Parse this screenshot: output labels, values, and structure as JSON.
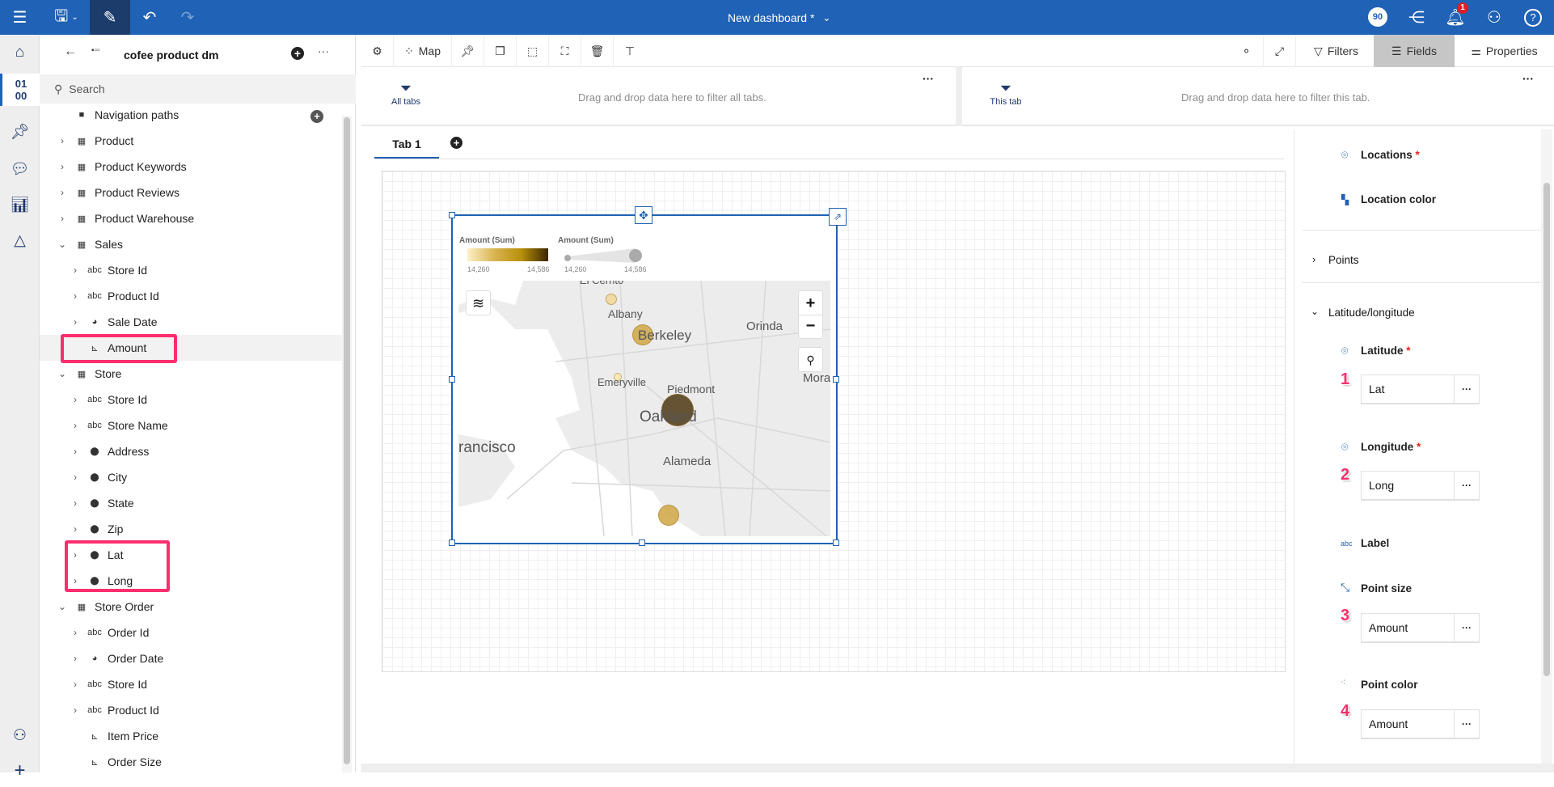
{
  "topbar": {
    "title": "New dashboard *",
    "badge": "90",
    "notifications": "1"
  },
  "leftpanel": {
    "title": "cofee product dm",
    "search_placeholder": "Search",
    "tree": [
      {
        "label": "Navigation paths",
        "icon": "folder-icon",
        "level": 0,
        "chev": ""
      },
      {
        "label": "Product",
        "icon": "table-icon",
        "level": 0,
        "chev": ">"
      },
      {
        "label": "Product Keywords",
        "icon": "table-icon",
        "level": 0,
        "chev": ">"
      },
      {
        "label": "Product Reviews",
        "icon": "table-icon",
        "level": 0,
        "chev": ">"
      },
      {
        "label": "Product Warehouse",
        "icon": "table-icon",
        "level": 0,
        "chev": ">"
      },
      {
        "label": "Sales",
        "icon": "table-icon",
        "level": 0,
        "chev": "v"
      },
      {
        "label": "Store Id",
        "icon": "text-icon",
        "level": 1,
        "chev": ">"
      },
      {
        "label": "Product Id",
        "icon": "text-icon",
        "level": 1,
        "chev": ">"
      },
      {
        "label": "Sale Date",
        "icon": "clock-icon",
        "level": 1,
        "chev": ">"
      },
      {
        "label": "Amount",
        "icon": "measure-icon",
        "level": 1,
        "chev": ""
      },
      {
        "label": "Store",
        "icon": "table-icon",
        "level": 0,
        "chev": "v"
      },
      {
        "label": "Store Id",
        "icon": "text-icon",
        "level": 1,
        "chev": ">"
      },
      {
        "label": "Store Name",
        "icon": "text-icon",
        "level": 1,
        "chev": ">"
      },
      {
        "label": "Address",
        "icon": "location-icon",
        "level": 1,
        "chev": ">"
      },
      {
        "label": "City",
        "icon": "location-icon",
        "level": 1,
        "chev": ">"
      },
      {
        "label": "State",
        "icon": "location-icon",
        "level": 1,
        "chev": ">"
      },
      {
        "label": "Zip",
        "icon": "location-icon",
        "level": 1,
        "chev": ">"
      },
      {
        "label": "Lat",
        "icon": "location-icon",
        "level": 1,
        "chev": ">"
      },
      {
        "label": "Long",
        "icon": "location-icon",
        "level": 1,
        "chev": ">"
      },
      {
        "label": "Store Order",
        "icon": "table-icon",
        "level": 0,
        "chev": "v"
      },
      {
        "label": "Order Id",
        "icon": "text-icon",
        "level": 1,
        "chev": ">"
      },
      {
        "label": "Order Date",
        "icon": "clock-icon",
        "level": 1,
        "chev": ">"
      },
      {
        "label": "Store Id",
        "icon": "text-icon",
        "level": 1,
        "chev": ">"
      },
      {
        "label": "Product Id",
        "icon": "text-icon",
        "level": 1,
        "chev": ">"
      },
      {
        "label": "Item Price",
        "icon": "measure-icon",
        "level": 1,
        "chev": ""
      },
      {
        "label": "Order Size",
        "icon": "measure-icon",
        "level": 1,
        "chev": ""
      }
    ]
  },
  "toolbar": {
    "map_label": "Map",
    "filters": "Filters",
    "fields": "Fields",
    "properties": "Properties"
  },
  "filters": {
    "all_tabs": "All tabs",
    "all_msg": "Drag and drop data here to filter all tabs.",
    "this_tab": "This tab",
    "this_msg": "Drag and drop data here to filter this tab."
  },
  "tabs": [
    {
      "label": "Tab 1",
      "active": true
    }
  ],
  "map": {
    "legend_color": {
      "title": "Amount (Sum)",
      "min": "14,260",
      "max": "14,586",
      "colors": [
        "#fdf0c8",
        "#b8900a",
        "#3a2600"
      ]
    },
    "legend_size": {
      "title": "Amount (Sum)",
      "min": "14,260",
      "max": "14,586"
    },
    "places": [
      "El Cerrito",
      "Albany",
      "Berkeley",
      "Orinda",
      "Emeryville",
      "Piedmont",
      "Oakland",
      "Moraga",
      "rancisco",
      "Alameda"
    ],
    "points": [
      {
        "place": "El Cerrito",
        "color": "#f3d9a0"
      },
      {
        "place": "Berkeley",
        "color": "#d3ad52"
      },
      {
        "place": "Emeryville",
        "color": "#fbe9b5"
      },
      {
        "place": "Oakland",
        "color": "#5a4724"
      },
      {
        "place": "Alameda",
        "color": "#d4ac52"
      }
    ]
  },
  "rightpanel": {
    "locations": "Locations",
    "location_color": "Location color",
    "points": "Points",
    "latlong": "Latitude/longitude",
    "latitude": "Latitude",
    "latitude_value": "Lat",
    "longitude": "Longitude",
    "longitude_value": "Long",
    "label": "Label",
    "point_size": "Point size",
    "point_size_value": "Amount",
    "point_color": "Point color",
    "point_color_value": "Amount",
    "required": "*",
    "steps": [
      "1",
      "2",
      "3",
      "4"
    ]
  },
  "accent": "#2062b5",
  "highlight": "#fb2e6e"
}
